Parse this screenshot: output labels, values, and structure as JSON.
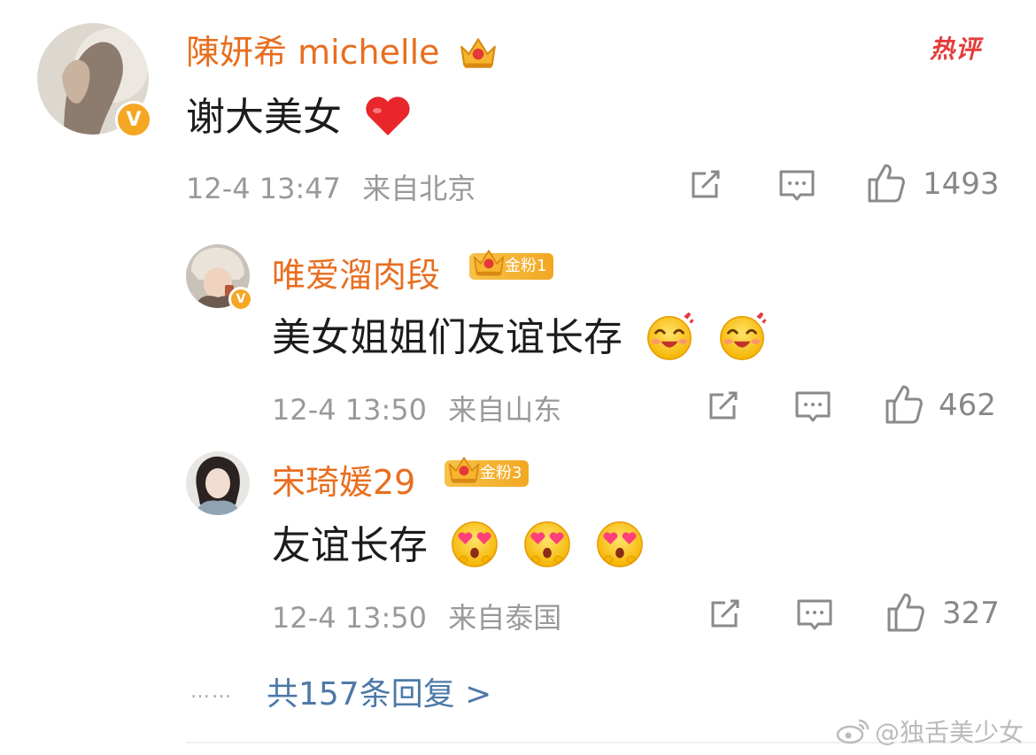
{
  "hot_label": "热评",
  "comments": [
    {
      "username": "陳妍希 michelle",
      "text": "谢大美女",
      "time": "12-4 13:47",
      "location": "来自北京",
      "likes": "1493"
    },
    {
      "username": "唯爱溜肉段",
      "badge": "金粉1",
      "text": "美女姐姐们友谊长存",
      "time": "12-4 13:50",
      "location": "来自山东",
      "likes": "462"
    },
    {
      "username": "宋琦媛29",
      "badge": "金粉3",
      "text": "友谊长存",
      "time": "12-4 13:50",
      "location": "来自泰国",
      "likes": "327"
    }
  ],
  "more_replies": "共157条回复 >",
  "more_dots": "……",
  "watermark": "@独舌美少女",
  "icons": {
    "share": "share-icon",
    "comment": "comment-icon",
    "like": "thumbs-up-icon",
    "crown": "crown-icon",
    "verified": "verified-v-icon",
    "heart": "red-heart-icon",
    "emoji_happy": "blushing-happy-emoji",
    "emoji_love": "heart-eyes-emoji"
  },
  "colors": {
    "username": "#e86e1f",
    "meta": "#999999",
    "link": "#4e79a7",
    "hot": "#e63b3b",
    "badge": "#f2a823"
  }
}
